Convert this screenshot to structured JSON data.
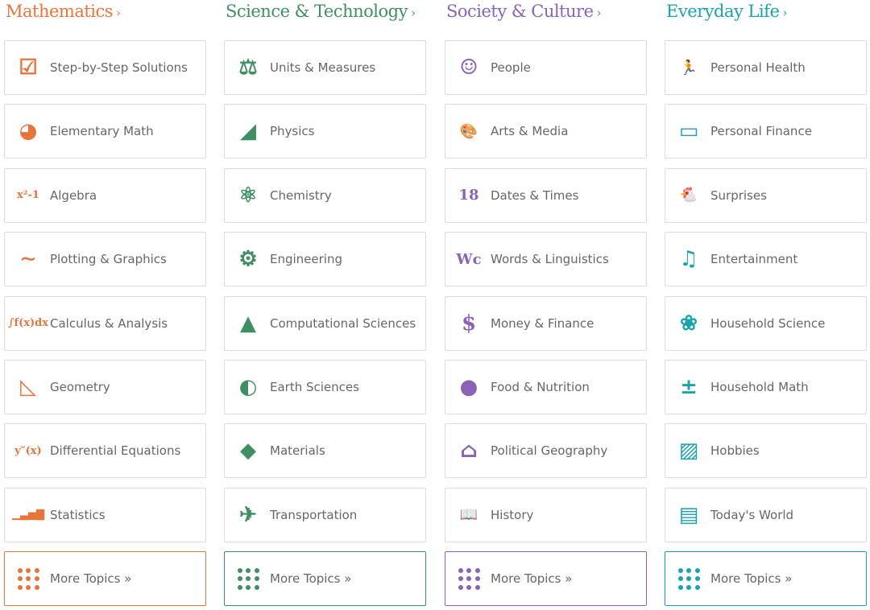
{
  "columns": [
    {
      "title": "Mathematics",
      "chevron": "›",
      "color": "#e8743b",
      "more_label": "More Topics »",
      "more_icon": "grid-dots-icon",
      "items": [
        {
          "label": "Step-by-Step Solutions",
          "icon": "checklist-icon",
          "glyph": "☑"
        },
        {
          "label": "Elementary Math",
          "icon": "pie-chart-icon",
          "glyph": "◕"
        },
        {
          "label": "Algebra",
          "icon": "x-squared-icon",
          "glyph": "x²-1"
        },
        {
          "label": "Plotting & Graphics",
          "icon": "plot-curve-icon",
          "glyph": "∼"
        },
        {
          "label": "Calculus & Analysis",
          "icon": "integral-icon",
          "glyph": "∫f(x)dx"
        },
        {
          "label": "Geometry",
          "icon": "triangle-icon",
          "glyph": "◺"
        },
        {
          "label": "Differential Equations",
          "icon": "y-double-prime-icon",
          "glyph": "y″(x)"
        },
        {
          "label": "Statistics",
          "icon": "bar-chart-icon",
          "glyph": "▁▃▅▇"
        }
      ]
    },
    {
      "title": "Science & Technology",
      "chevron": "›",
      "color": "#3f8f63",
      "more_label": "More Topics »",
      "more_icon": "grid-dots-icon",
      "items": [
        {
          "label": "Units & Measures",
          "icon": "weight-thermometer-icon",
          "glyph": "⚖"
        },
        {
          "label": "Physics",
          "icon": "physics-incline-icon",
          "glyph": "◢"
        },
        {
          "label": "Chemistry",
          "icon": "molecule-icon",
          "glyph": "⚛"
        },
        {
          "label": "Engineering",
          "icon": "gears-icon",
          "glyph": "⚙"
        },
        {
          "label": "Computational Sciences",
          "icon": "triangle-pattern-icon",
          "glyph": "▲"
        },
        {
          "label": "Earth Sciences",
          "icon": "globe-icon",
          "glyph": "◐"
        },
        {
          "label": "Materials",
          "icon": "diamond-icon",
          "glyph": "◆"
        },
        {
          "label": "Transportation",
          "icon": "airplane-icon",
          "glyph": "✈"
        }
      ]
    },
    {
      "title": "Society & Culture",
      "chevron": "›",
      "color": "#8a63b8",
      "more_label": "More Topics »",
      "more_icon": "grid-dots-icon",
      "items": [
        {
          "label": "People",
          "icon": "person-portrait-icon",
          "glyph": "☺"
        },
        {
          "label": "Arts & Media",
          "icon": "palette-icon",
          "glyph": "🎨"
        },
        {
          "label": "Dates & Times",
          "icon": "calendar-icon",
          "glyph": "18"
        },
        {
          "label": "Words & Linguistics",
          "icon": "letters-icon",
          "glyph": "Wc"
        },
        {
          "label": "Money & Finance",
          "icon": "piggy-bank-icon",
          "glyph": "$"
        },
        {
          "label": "Food & Nutrition",
          "icon": "apple-icon",
          "glyph": "●"
        },
        {
          "label": "Political Geography",
          "icon": "capitol-icon",
          "glyph": "⌂"
        },
        {
          "label": "History",
          "icon": "book-icon",
          "glyph": "📖"
        }
      ]
    },
    {
      "title": "Everyday Life",
      "chevron": "›",
      "color": "#1ba3ad",
      "more_label": "More Topics »",
      "more_icon": "grid-dots-icon",
      "items": [
        {
          "label": "Personal Health",
          "icon": "runner-icon",
          "glyph": "🏃"
        },
        {
          "label": "Personal Finance",
          "icon": "check-card-icon",
          "glyph": "▭"
        },
        {
          "label": "Surprises",
          "icon": "chicken-icon",
          "glyph": "🐔"
        },
        {
          "label": "Entertainment",
          "icon": "music-staff-icon",
          "glyph": "♫"
        },
        {
          "label": "Household Science",
          "icon": "grapes-icon",
          "glyph": "❀"
        },
        {
          "label": "Household Math",
          "icon": "calculator-icon",
          "glyph": "±"
        },
        {
          "label": "Hobbies",
          "icon": "picture-icon",
          "glyph": "▨"
        },
        {
          "label": "Today's World",
          "icon": "stock-ticker-icon",
          "glyph": "▤"
        }
      ]
    }
  ]
}
